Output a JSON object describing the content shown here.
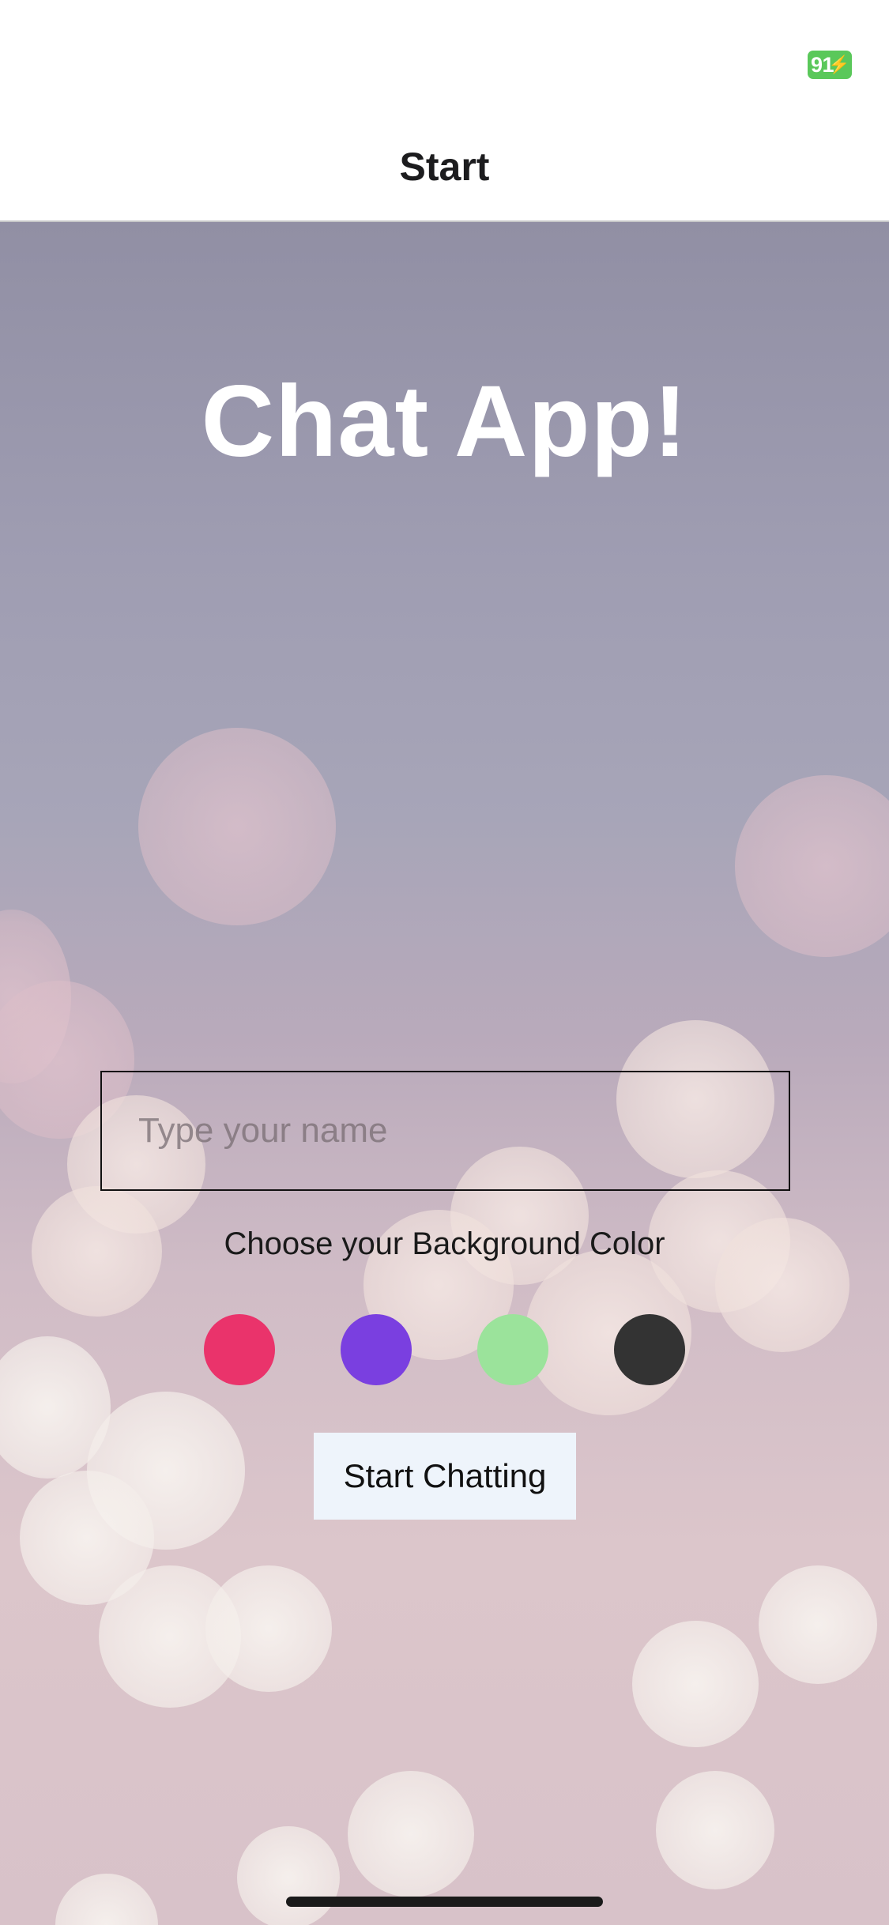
{
  "status_bar": {
    "battery_level": "91",
    "battery_color": "#5ac85a",
    "charging": true
  },
  "nav": {
    "title": "Start"
  },
  "app": {
    "title": "Chat App!"
  },
  "name_input": {
    "value": "",
    "placeholder": "Type your name"
  },
  "color_chooser": {
    "label": "Choose your Background Color",
    "colors": [
      "#ea336b",
      "#7a3fe0",
      "#9be39b",
      "#333333"
    ]
  },
  "start_button": {
    "label": "Start Chatting"
  }
}
